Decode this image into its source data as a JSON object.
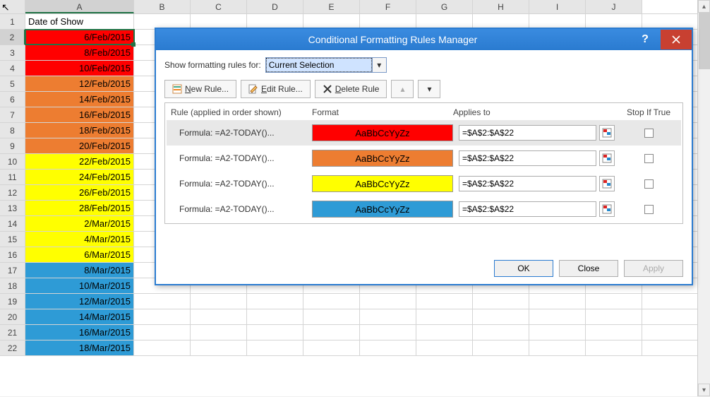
{
  "sheet": {
    "columns": [
      "A",
      "B",
      "C",
      "D",
      "E",
      "F",
      "G",
      "H",
      "I",
      "J"
    ],
    "activeColumn": "A",
    "activeRow": 2,
    "rows": [
      {
        "n": 1,
        "a": "Date of Show",
        "fill": "",
        "header": true
      },
      {
        "n": 2,
        "a": "6/Feb/2015",
        "fill": "red",
        "selected": true
      },
      {
        "n": 3,
        "a": "8/Feb/2015",
        "fill": "red"
      },
      {
        "n": 4,
        "a": "10/Feb/2015",
        "fill": "red"
      },
      {
        "n": 5,
        "a": "12/Feb/2015",
        "fill": "orange"
      },
      {
        "n": 6,
        "a": "14/Feb/2015",
        "fill": "orange"
      },
      {
        "n": 7,
        "a": "16/Feb/2015",
        "fill": "orange"
      },
      {
        "n": 8,
        "a": "18/Feb/2015",
        "fill": "orange"
      },
      {
        "n": 9,
        "a": "20/Feb/2015",
        "fill": "orange"
      },
      {
        "n": 10,
        "a": "22/Feb/2015",
        "fill": "yellow"
      },
      {
        "n": 11,
        "a": "24/Feb/2015",
        "fill": "yellow"
      },
      {
        "n": 12,
        "a": "26/Feb/2015",
        "fill": "yellow"
      },
      {
        "n": 13,
        "a": "28/Feb/2015",
        "fill": "yellow"
      },
      {
        "n": 14,
        "a": "2/Mar/2015",
        "fill": "yellow"
      },
      {
        "n": 15,
        "a": "4/Mar/2015",
        "fill": "yellow"
      },
      {
        "n": 16,
        "a": "6/Mar/2015",
        "fill": "yellow"
      },
      {
        "n": 17,
        "a": "8/Mar/2015",
        "fill": "blue"
      },
      {
        "n": 18,
        "a": "10/Mar/2015",
        "fill": "blue"
      },
      {
        "n": 19,
        "a": "12/Mar/2015",
        "fill": "blue"
      },
      {
        "n": 20,
        "a": "14/Mar/2015",
        "fill": "blue"
      },
      {
        "n": 21,
        "a": "16/Mar/2015",
        "fill": "blue"
      },
      {
        "n": 22,
        "a": "18/Mar/2015",
        "fill": "blue"
      }
    ]
  },
  "dialog": {
    "title": "Conditional Formatting Rules Manager",
    "showRulesLabel": "Show formatting rules for:",
    "showRulesValue": "Current Selection",
    "buttons": {
      "newRule": "New Rule...",
      "editRule": "Edit Rule...",
      "deleteRule": "Delete Rule"
    },
    "headers": {
      "rule": "Rule (applied in order shown)",
      "format": "Format",
      "applies": "Applies to",
      "stop": "Stop If True"
    },
    "formatSample": "AaBbCcYyZz",
    "rules": [
      {
        "label": "Formula: =A2-TODAY()...",
        "fmt": "red",
        "applies": "=$A$2:$A$22",
        "selected": true
      },
      {
        "label": "Formula: =A2-TODAY()...",
        "fmt": "orange",
        "applies": "=$A$2:$A$22"
      },
      {
        "label": "Formula: =A2-TODAY()...",
        "fmt": "yellow",
        "applies": "=$A$2:$A$22"
      },
      {
        "label": "Formula: =A2-TODAY()...",
        "fmt": "blue",
        "applies": "=$A$2:$A$22"
      }
    ],
    "footer": {
      "ok": "OK",
      "close": "Close",
      "apply": "Apply"
    }
  }
}
